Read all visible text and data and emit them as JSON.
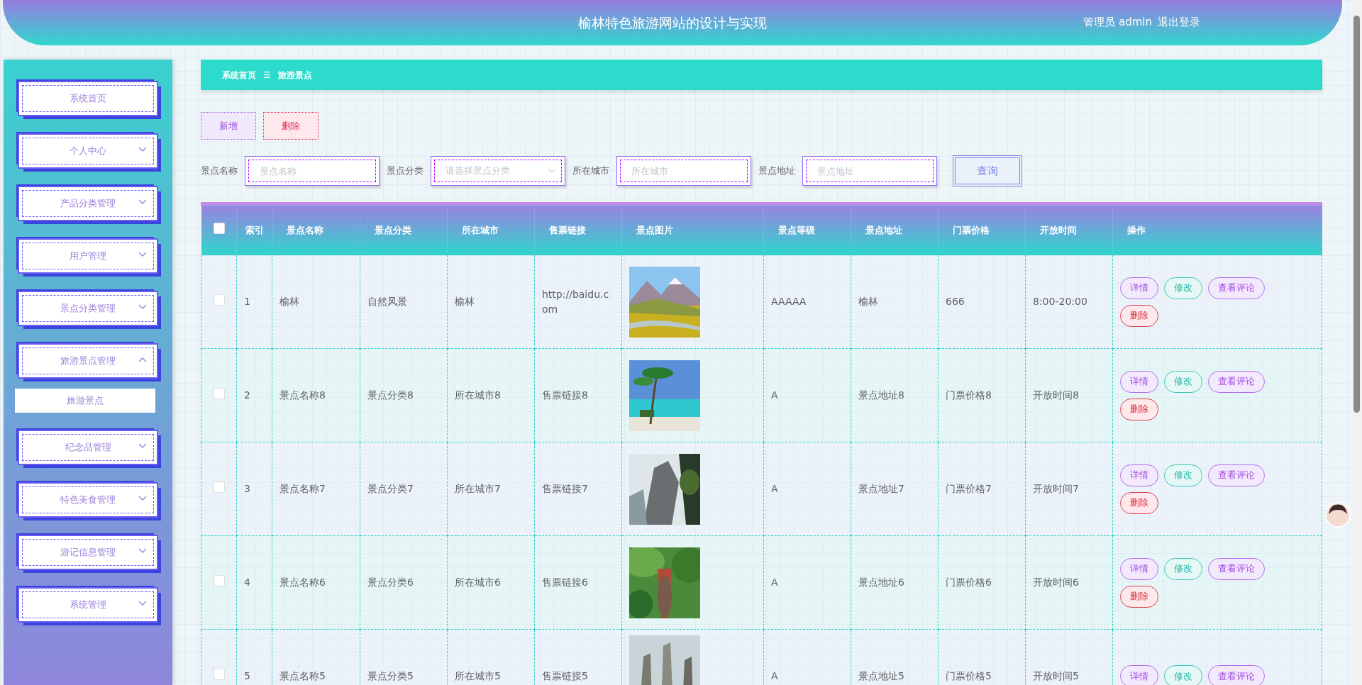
{
  "header": {
    "title": "榆林特色旅游网站的设计与实现",
    "user": "管理员 admin",
    "logout": "退出登录"
  },
  "sidebar": {
    "items": [
      {
        "label": "系统首页",
        "kind": "link"
      },
      {
        "label": "个人中心",
        "kind": "submenu",
        "expanded": false
      },
      {
        "label": "产品分类管理",
        "kind": "submenu",
        "expanded": false
      },
      {
        "label": "用户管理",
        "kind": "submenu",
        "expanded": false
      },
      {
        "label": "景点分类管理",
        "kind": "submenu",
        "expanded": false
      },
      {
        "label": "旅游景点管理",
        "kind": "submenu",
        "expanded": true,
        "children": [
          {
            "label": "旅游景点",
            "selected": true
          }
        ]
      },
      {
        "label": "纪念品管理",
        "kind": "submenu",
        "expanded": false
      },
      {
        "label": "特色美食管理",
        "kind": "submenu",
        "expanded": false
      },
      {
        "label": "游记信息管理",
        "kind": "submenu",
        "expanded": false
      },
      {
        "label": "系统管理",
        "kind": "submenu",
        "expanded": false
      }
    ]
  },
  "breadcrumb": {
    "home": "系统首页",
    "separator": "☰",
    "current": "旅游景点"
  },
  "toolbar": {
    "add": "新增",
    "delete": "删除"
  },
  "filters": [
    {
      "label": "景点名称",
      "kind": "input",
      "placeholder": "景点名称"
    },
    {
      "label": "景点分类",
      "kind": "select",
      "placeholder": "请选择景点分类"
    },
    {
      "label": "所在城市",
      "kind": "input",
      "placeholder": "所在城市"
    },
    {
      "label": "景点地址",
      "kind": "input",
      "placeholder": "景点地址"
    }
  ],
  "search_button": "查询",
  "table": {
    "all_checked": false,
    "columns": [
      "索引",
      "景点名称",
      "景点分类",
      "所在城市",
      "售票链接",
      "景点图片",
      "景点等级",
      "景点地址",
      "门票价格",
      "开放时间",
      "操作"
    ],
    "rows": [
      {
        "selected": false,
        "index": "1",
        "name": "榆林",
        "category": "自然风景",
        "city": "榆林",
        "link": "http://baidu.com",
        "level": "AAAAA",
        "address": "榆林",
        "price": "666",
        "hours": "8:00-20:00",
        "actions": [
          "详情",
          "修改",
          "查看评论",
          "删除"
        ]
      },
      {
        "selected": false,
        "index": "2",
        "name": "景点名称8",
        "category": "景点分类8",
        "city": "所在城市8",
        "link": "售票链接8",
        "level": "A",
        "address": "景点地址8",
        "price": "门票价格8",
        "hours": "开放时间8",
        "actions": [
          "详情",
          "修改",
          "查看评论",
          "删除"
        ]
      },
      {
        "selected": false,
        "index": "3",
        "name": "景点名称7",
        "category": "景点分类7",
        "city": "所在城市7",
        "link": "售票链接7",
        "level": "A",
        "address": "景点地址7",
        "price": "门票价格7",
        "hours": "开放时间7",
        "actions": [
          "详情",
          "修改",
          "查看评论",
          "删除"
        ]
      },
      {
        "selected": false,
        "index": "4",
        "name": "景点名称6",
        "category": "景点分类6",
        "city": "所在城市6",
        "link": "售票链接6",
        "level": "A",
        "address": "景点地址6",
        "price": "门票价格6",
        "hours": "开放时间6",
        "actions": [
          "详情",
          "修改",
          "查看评论",
          "删除"
        ]
      },
      {
        "selected": false,
        "index": "5",
        "name": "景点名称5",
        "category": "景点分类5",
        "city": "所在城市5",
        "link": "售票链接5",
        "level": "A",
        "address": "景点地址5",
        "price": "门票价格5",
        "hours": "开放时间5",
        "actions": [
          "详情",
          "修改",
          "查看评论"
        ]
      }
    ]
  }
}
